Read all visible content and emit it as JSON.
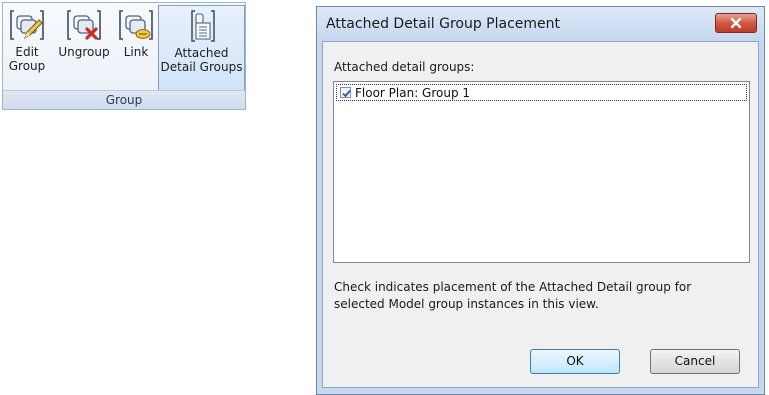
{
  "ribbon": {
    "buttons": [
      {
        "label_line1": "Edit",
        "label_line2": "Group",
        "icon": "edit-group-icon"
      },
      {
        "label_line1": "Ungroup",
        "label_line2": "",
        "icon": "ungroup-icon"
      },
      {
        "label_line1": "Link",
        "label_line2": "",
        "icon": "link-group-icon"
      },
      {
        "label_line1": "Attached",
        "label_line2": "Detail Groups",
        "icon": "attached-detail-groups-icon"
      }
    ],
    "panel_title": "Group"
  },
  "dialog": {
    "title": "Attached Detail Group Placement",
    "close_icon": "close-icon",
    "list_label": "Attached detail groups:",
    "items": [
      {
        "label": "Floor Plan: Group 1",
        "checked": true
      }
    ],
    "description_line1": "Check indicates placement of the Attached Detail group for",
    "description_line2": "selected Model group instances in this view.",
    "ok_label": "OK",
    "cancel_label": "Cancel"
  },
  "colors": {
    "dialog_frame": "#c7d8ee",
    "close_button": "#d1533f",
    "ribbon_active": "#d2e3f8",
    "check_mark": "#2b56a8"
  }
}
